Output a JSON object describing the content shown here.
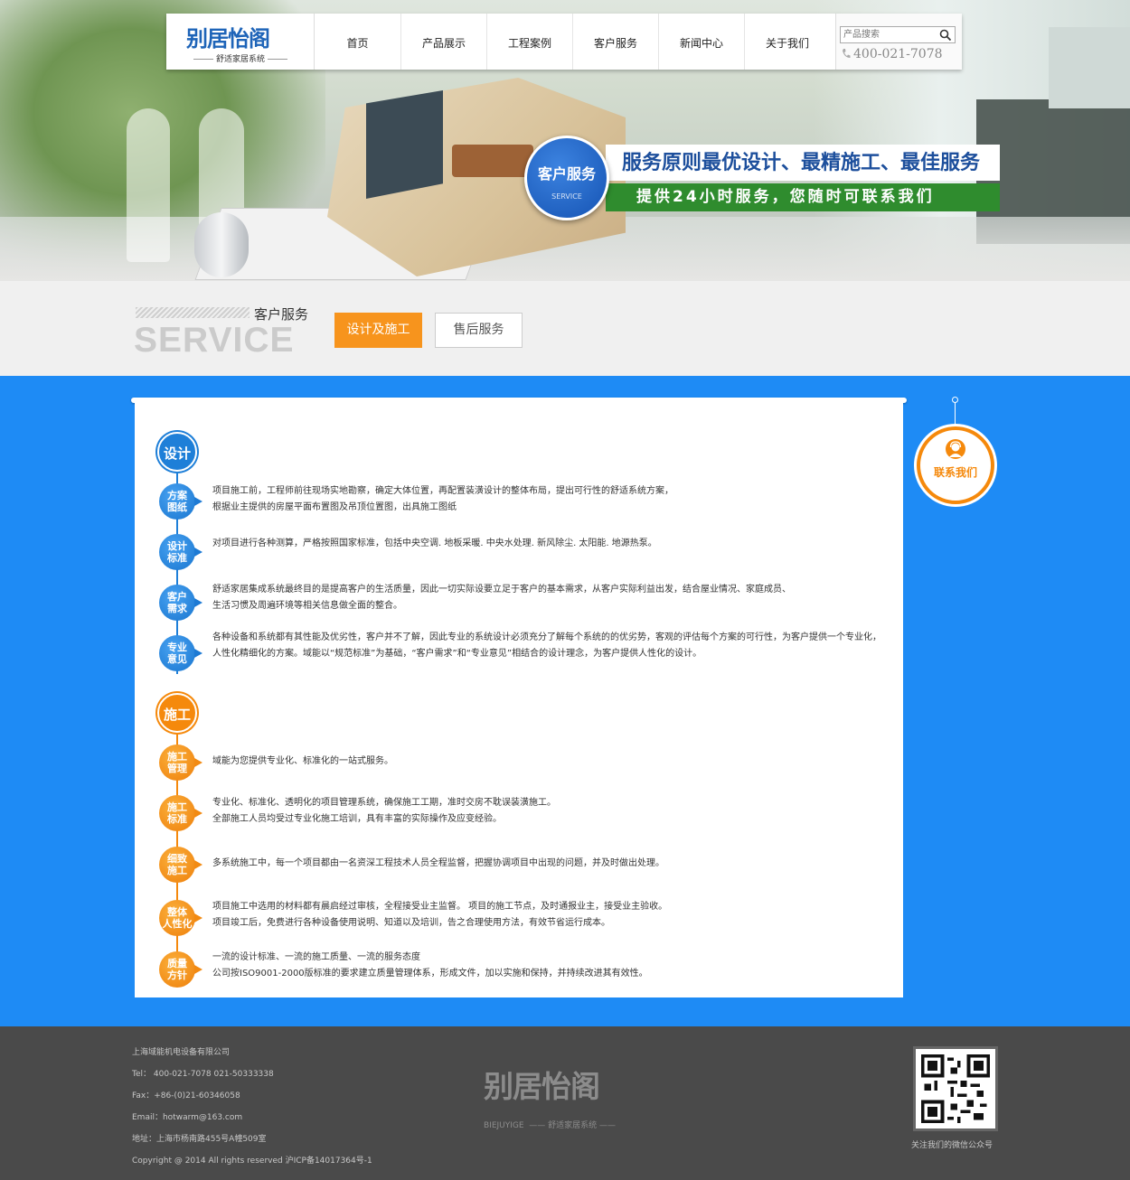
{
  "brand": {
    "logo_text": "别居怡阁",
    "logo_pinyin": "BIEJUYIGE",
    "logo_sub": "舒适家居系统"
  },
  "nav": {
    "items": [
      "首页",
      "产品展示",
      "工程案例",
      "客户服务",
      "新闻中心",
      "关于我们"
    ]
  },
  "search": {
    "placeholder": "产品搜索",
    "icon": "search-icon"
  },
  "phone": "400-021-7078",
  "banner": {
    "circle_title": "客户服务",
    "circle_en": "SERVICE",
    "line1": "服务原则最优设计、最精施工、最佳服务",
    "line2": "提供24小时服务，您随时可联系我们"
  },
  "service": {
    "title": "客户服务",
    "title_en": "SERVICE",
    "tabs": [
      "设计及施工",
      "售后服务"
    ]
  },
  "sections": {
    "design": {
      "label": "设计",
      "rows": [
        {
          "icon": [
            "方案",
            "图纸"
          ],
          "lines": [
            "项目施工前，工程师前往现场实地勘察，确定大体位置，再配置装潢设计的整体布局，提出可行性的舒适系统方案，",
            "根据业主提供的房屋平面布置图及吊顶位置图，出具施工图纸"
          ]
        },
        {
          "icon": [
            "设计",
            "标准"
          ],
          "lines": [
            "对项目进行各种测算，严格按照国家标准，包括中央空调. 地板采暖. 中央水处理. 新风除尘. 太阳能. 地源热泵。"
          ]
        },
        {
          "icon": [
            "客户",
            "需求"
          ],
          "lines": [
            "舒适家居集成系统最终目的是提高客户的生活质量，因此一切实际设要立足于客户的基本需求，从客户实际利益出发，结合屋业情况、家庭成员、",
            "生活习惯及周遍环境等相关信息做全面的整合。"
          ]
        },
        {
          "icon": [
            "专业",
            "意见"
          ],
          "lines": [
            "各种设备和系统都有其性能及优劣性，客户并不了解，因此专业的系统设计必须充分了解每个系统的的优劣势，客观的评估每个方案的可行性，为客户提供一个专业化，",
            "人性化精细化的方案。域能以“规范标准”为基础，“客户需求”和“专业意见”相结合的设计理念，为客户提供人性化的设计。"
          ]
        }
      ]
    },
    "construction": {
      "label": "施工",
      "rows": [
        {
          "icon": [
            "施工",
            "管理"
          ],
          "lines": [
            "域能为您提供专业化、标准化的一站式服务。"
          ]
        },
        {
          "icon": [
            "施工",
            "标准"
          ],
          "lines": [
            "专业化、标准化、透明化的项目管理系统，确保施工工期，准时交房不耽误装潢施工。",
            "全部施工人员均受过专业化施工培训，具有丰富的实际操作及应变经验。"
          ]
        },
        {
          "icon": [
            "细致",
            "施工"
          ],
          "lines": [
            "多系统施工中，每一个项目都由一名资深工程技术人员全程监督，把握协调项目中出现的问题，并及时做出处理。"
          ]
        },
        {
          "icon": [
            "整体",
            "人性化"
          ],
          "lines": [
            "项目施工中选用的材料都有晨启经过审核，全程接受业主监督。 项目的施工节点，及时通报业主，接受业主验收。",
            "项目竣工后，免费进行各种设备使用说明、知道以及培训，告之合理使用方法，有效节省运行成本。"
          ]
        },
        {
          "icon": [
            "质量",
            "方针"
          ],
          "lines": [
            "一流的设计标准、一流的施工质量、一流的服务态度",
            "公司按ISO9001-2000版标准的要求建立质量管理体系，形成文件，加以实施和保持，并持续改进其有效性。"
          ]
        }
      ]
    }
  },
  "contact": {
    "label": "联系我们",
    "icon": "support-agent-icon"
  },
  "footer": {
    "company": "上海域能机电设备有限公司",
    "tel": "Tel： 400-021-7078  021-50333338",
    "fax": "Fax：+86-(0)21-60346058",
    "email": "Email：hotwarm@163.com",
    "address": "地址：上海市杨南路455号A幢509室",
    "copyright": "Copyright @ 2014 All rights reserved 沪ICP备14017364号-1",
    "qr_caption": "关注我们的微信公众号"
  },
  "colors": {
    "brand_blue": "#1e64b8",
    "content_blue": "#1e8bf5",
    "accent_orange": "#f5890c",
    "slogan_green": "#2f8c2e",
    "footer_gray": "#4a4a4a"
  }
}
